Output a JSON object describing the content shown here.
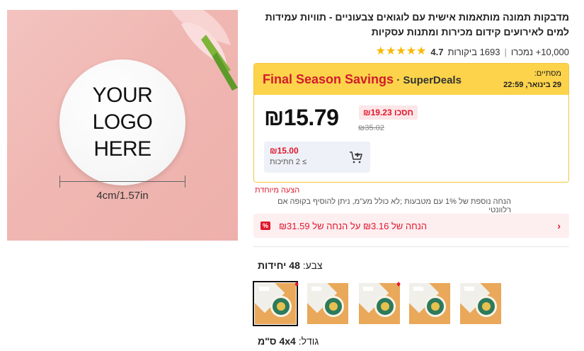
{
  "product": {
    "image": {
      "logo_lines": [
        "YOUR",
        "LOGO",
        "HERE"
      ],
      "dimension_label": "4cm/1.57in"
    },
    "title": "מדבקות תמונה מותאמות אישית עם לוגואים צבעוניים - תוויות עמידות למים לאירועים קידום מכירות ומתנות עסקיות",
    "rating": "4.7",
    "reviews": "1693 ביקורות",
    "sold": "10,000+ נמכרו"
  },
  "deal": {
    "title": "Final Season Savings",
    "brand": "SuperDeals",
    "ends_label": "מסתיים:",
    "ends_date": "29 בינואר, 22:59",
    "price": "₪15.79",
    "save_badge": "חסכו ₪19.23",
    "old_price": "₪35.02",
    "bulk_price": "₪15.00",
    "bulk_qty": "≥ 2 חתיכות"
  },
  "extra_discount": {
    "title": "הצעה מיוחדת",
    "text": "הנחה נוספת של 1% עם מטבעות ;לא כולל מע\"מ, ניתן להוסיף בקופה אם רלוונטי"
  },
  "coupon": {
    "icon_text": "%",
    "text": "הנחה של ₪3.16 על הנחה של ₪31.59"
  },
  "variants": {
    "color_label": "צבע:",
    "color_value": "48 יחידות",
    "swatch_count": 5,
    "size_label": "גודל:",
    "size_value": "4x4 ס\"מ"
  },
  "colors": {
    "accent": "#e0182d",
    "deal_header": "#fcd34a",
    "star": "#fbb800"
  }
}
